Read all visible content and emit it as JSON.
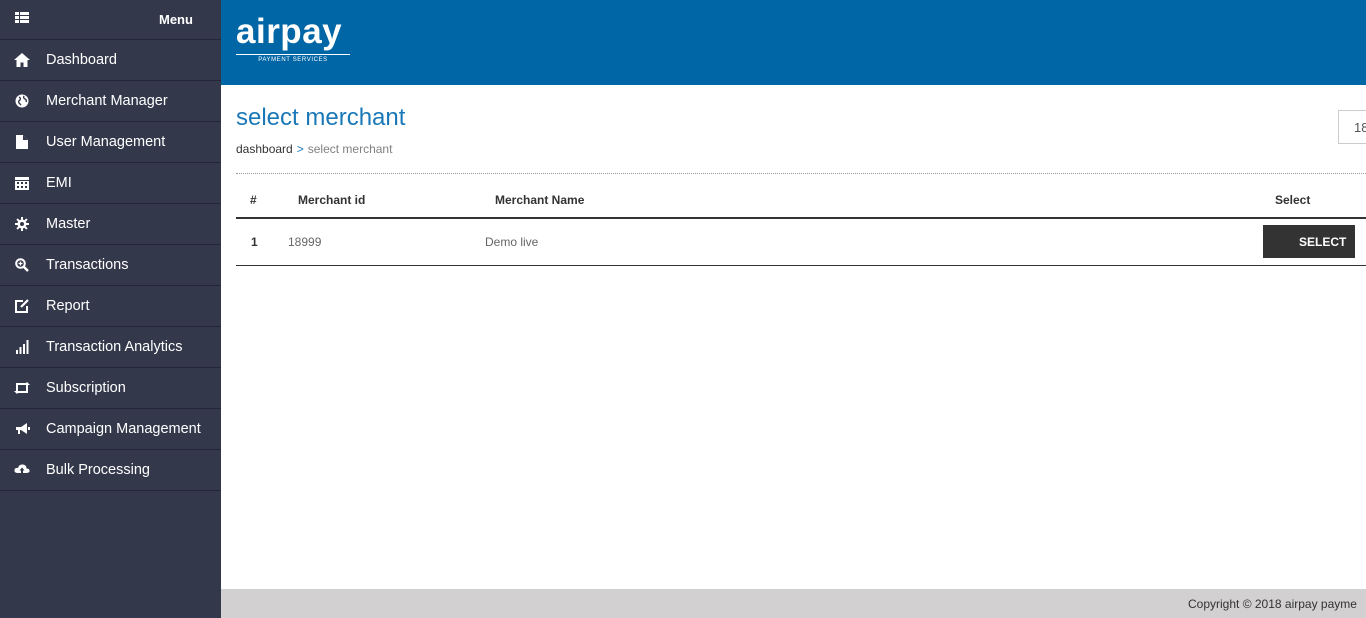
{
  "sidebar": {
    "menu_label": "Menu",
    "items": [
      {
        "label": "Dashboard",
        "icon": "home-icon"
      },
      {
        "label": "Merchant Manager",
        "icon": "globe-icon"
      },
      {
        "label": "User Management",
        "icon": "file-icon"
      },
      {
        "label": "EMI",
        "icon": "calendar-icon"
      },
      {
        "label": "Master",
        "icon": "gear-icon"
      },
      {
        "label": "Transactions",
        "icon": "zoom-icon"
      },
      {
        "label": "Report",
        "icon": "edit-icon"
      },
      {
        "label": "Transaction Analytics",
        "icon": "signal-icon"
      },
      {
        "label": "Subscription",
        "icon": "retweet-icon"
      },
      {
        "label": "Campaign Management",
        "icon": "bullhorn-icon"
      },
      {
        "label": "Bulk Processing",
        "icon": "cloud-upload-icon"
      }
    ]
  },
  "header": {
    "logo_text": "airpay",
    "logo_subtext": "PAYMENT SERVICES",
    "brand_color": "#0066a6"
  },
  "page": {
    "title": "select merchant",
    "breadcrumb_home": "dashboard",
    "breadcrumb_sep": ">",
    "breadcrumb_current": "select merchant",
    "top_input_value": "18"
  },
  "table": {
    "headers": [
      "#",
      "Merchant id",
      "Merchant Name",
      "Select"
    ],
    "rows": [
      {
        "index": "1",
        "merchant_id": "18999",
        "merchant_name": "Demo live",
        "action_label": "SELECT"
      }
    ]
  },
  "footer": {
    "copyright": "Copyright © 2018 airpay payme"
  }
}
